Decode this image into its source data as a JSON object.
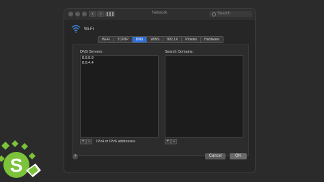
{
  "window": {
    "title": "Network",
    "search_placeholder": "Search"
  },
  "network": {
    "name": "Wi-Fi"
  },
  "tabs": [
    {
      "label": "Wi-Fi"
    },
    {
      "label": "TCP/IP"
    },
    {
      "label": "DNS",
      "active": true
    },
    {
      "label": "WINS"
    },
    {
      "label": "802.1X"
    },
    {
      "label": "Proxies"
    },
    {
      "label": "Hardware"
    }
  ],
  "dns": {
    "label": "DNS Servers:",
    "servers": [
      "8.8.8.8",
      "8.8.4.4"
    ]
  },
  "search_domains": {
    "label": "Search Domains:"
  },
  "controls": {
    "add": "+",
    "remove": "−",
    "hint": "IPv4 or IPv6 addresses"
  },
  "buttons": {
    "help": "?",
    "cancel": "Cancel",
    "ok": "OK"
  },
  "colors": {
    "accent": "#2f6fdc",
    "logo_green": "#7cc23a"
  },
  "icons": [
    "wifi-icon",
    "search-icon",
    "help-icon",
    "logo-icon"
  ]
}
